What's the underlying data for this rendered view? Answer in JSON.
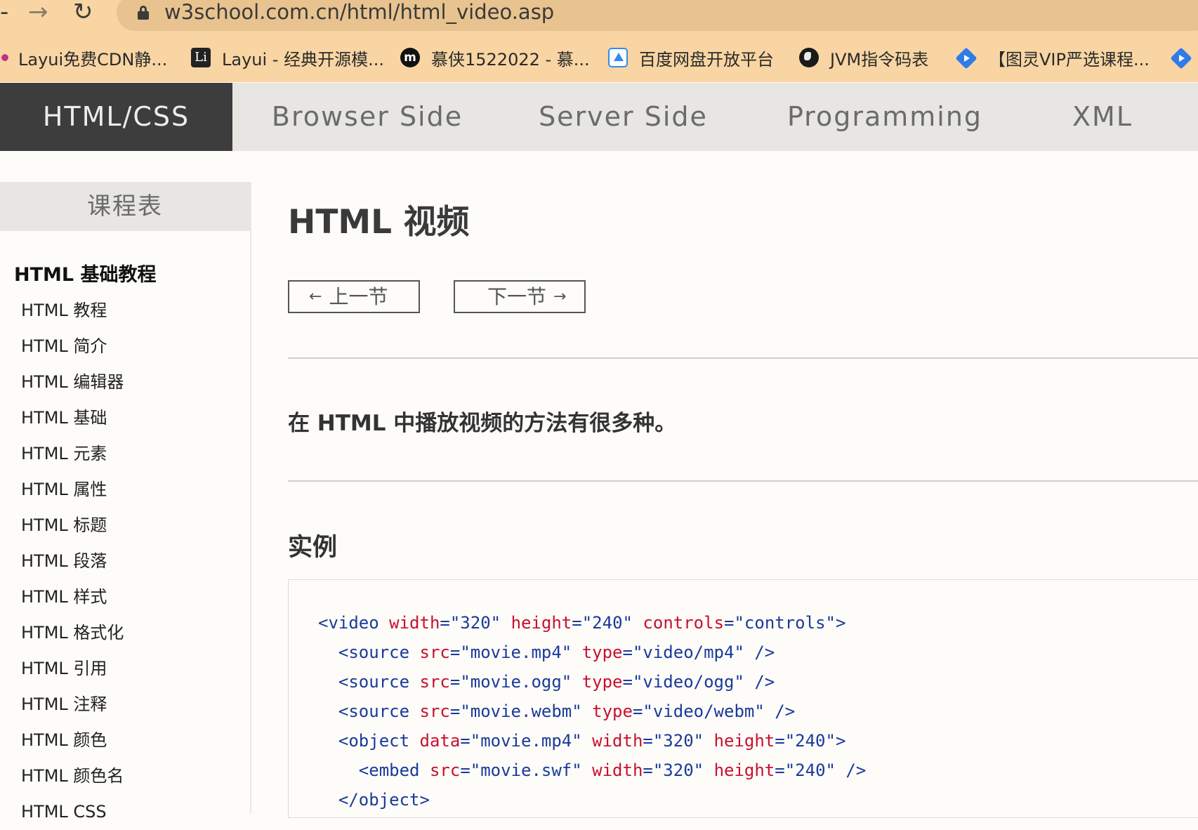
{
  "browser": {
    "url": "w3school.com.cn/html/html_video.asp",
    "back_icon": "-",
    "forward_icon": "→",
    "reload_icon": "↻",
    "bookmarks": [
      {
        "icon": "layui-cdn-icon",
        "label": "Layui免费CDN静..."
      },
      {
        "icon": "layui-icon",
        "icon_text": "Li",
        "label": "Layui - 经典开源模..."
      },
      {
        "icon": "mooc-icon",
        "icon_text": "m",
        "label": "慕侠1522022 - 慕..."
      },
      {
        "icon": "baidu-pan-icon",
        "label": "百度网盘开放平台"
      },
      {
        "icon": "jvm-globe-icon",
        "label": "JVM指令码表"
      },
      {
        "icon": "tuling-icon",
        "label": "【图灵VIP严选课程..."
      },
      {
        "icon": "tuling-icon",
        "label": ""
      }
    ]
  },
  "topnav": {
    "items": [
      "HTML/CSS",
      "Browser Side",
      "Server Side",
      "Programming",
      "XML"
    ],
    "active_index": 0
  },
  "sidebar": {
    "title": "课程表",
    "section": "HTML 基础教程",
    "items": [
      "HTML 教程",
      "HTML 简介",
      "HTML 编辑器",
      "HTML 基础",
      "HTML 元素",
      "HTML 属性",
      "HTML 标题",
      "HTML 段落",
      "HTML 样式",
      "HTML 格式化",
      "HTML 引用",
      "HTML 注释",
      "HTML 颜色",
      "HTML 颜色名",
      "HTML CSS"
    ]
  },
  "main": {
    "title": "HTML 视频",
    "prev_label": "上一节",
    "next_label": "下一节",
    "prev_arrow": "←",
    "next_arrow": "→",
    "intro": "在 HTML 中播放视频的方法有很多种。",
    "example_heading": "实例",
    "code_lines": [
      [
        [
          "tag",
          "<video "
        ],
        [
          "attr",
          "width"
        ],
        [
          "tag",
          "="
        ],
        [
          "val",
          "\"320\" "
        ],
        [
          "attr",
          "height"
        ],
        [
          "tag",
          "="
        ],
        [
          "val",
          "\"240\" "
        ],
        [
          "attr",
          "controls"
        ],
        [
          "tag",
          "="
        ],
        [
          "val",
          "\"controls\""
        ],
        [
          "tag",
          ">"
        ]
      ],
      [
        [
          "tag",
          "  <source "
        ],
        [
          "attr",
          "src"
        ],
        [
          "tag",
          "="
        ],
        [
          "val",
          "\"movie.mp4\" "
        ],
        [
          "attr",
          "type"
        ],
        [
          "tag",
          "="
        ],
        [
          "val",
          "\"video/mp4\" "
        ],
        [
          "tag",
          "/>"
        ]
      ],
      [
        [
          "tag",
          "  <source "
        ],
        [
          "attr",
          "src"
        ],
        [
          "tag",
          "="
        ],
        [
          "val",
          "\"movie.ogg\" "
        ],
        [
          "attr",
          "type"
        ],
        [
          "tag",
          "="
        ],
        [
          "val",
          "\"video/ogg\" "
        ],
        [
          "tag",
          "/>"
        ]
      ],
      [
        [
          "tag",
          "  <source "
        ],
        [
          "attr",
          "src"
        ],
        [
          "tag",
          "="
        ],
        [
          "val",
          "\"movie.webm\" "
        ],
        [
          "attr",
          "type"
        ],
        [
          "tag",
          "="
        ],
        [
          "val",
          "\"video/webm\" "
        ],
        [
          "tag",
          "/>"
        ]
      ],
      [
        [
          "tag",
          "  <object "
        ],
        [
          "attr",
          "data"
        ],
        [
          "tag",
          "="
        ],
        [
          "val",
          "\"movie.mp4\" "
        ],
        [
          "attr",
          "width"
        ],
        [
          "tag",
          "="
        ],
        [
          "val",
          "\"320\" "
        ],
        [
          "attr",
          "height"
        ],
        [
          "tag",
          "="
        ],
        [
          "val",
          "\"240\""
        ],
        [
          "tag",
          ">"
        ]
      ],
      [
        [
          "tag",
          "    <embed "
        ],
        [
          "attr",
          "src"
        ],
        [
          "tag",
          "="
        ],
        [
          "val",
          "\"movie.swf\" "
        ],
        [
          "attr",
          "width"
        ],
        [
          "tag",
          "="
        ],
        [
          "val",
          "\"320\" "
        ],
        [
          "attr",
          "height"
        ],
        [
          "tag",
          "="
        ],
        [
          "val",
          "\"240\" "
        ],
        [
          "tag",
          "/>"
        ]
      ],
      [
        [
          "tag",
          "  </object>"
        ]
      ]
    ]
  },
  "colors": {
    "chrome_bg": "#f8d5a3",
    "nav_active_bg": "#3d3d3d",
    "nav_bg": "#e7e6e3",
    "code_tag": "#1a3a9a",
    "code_attr": "#c8102e"
  }
}
